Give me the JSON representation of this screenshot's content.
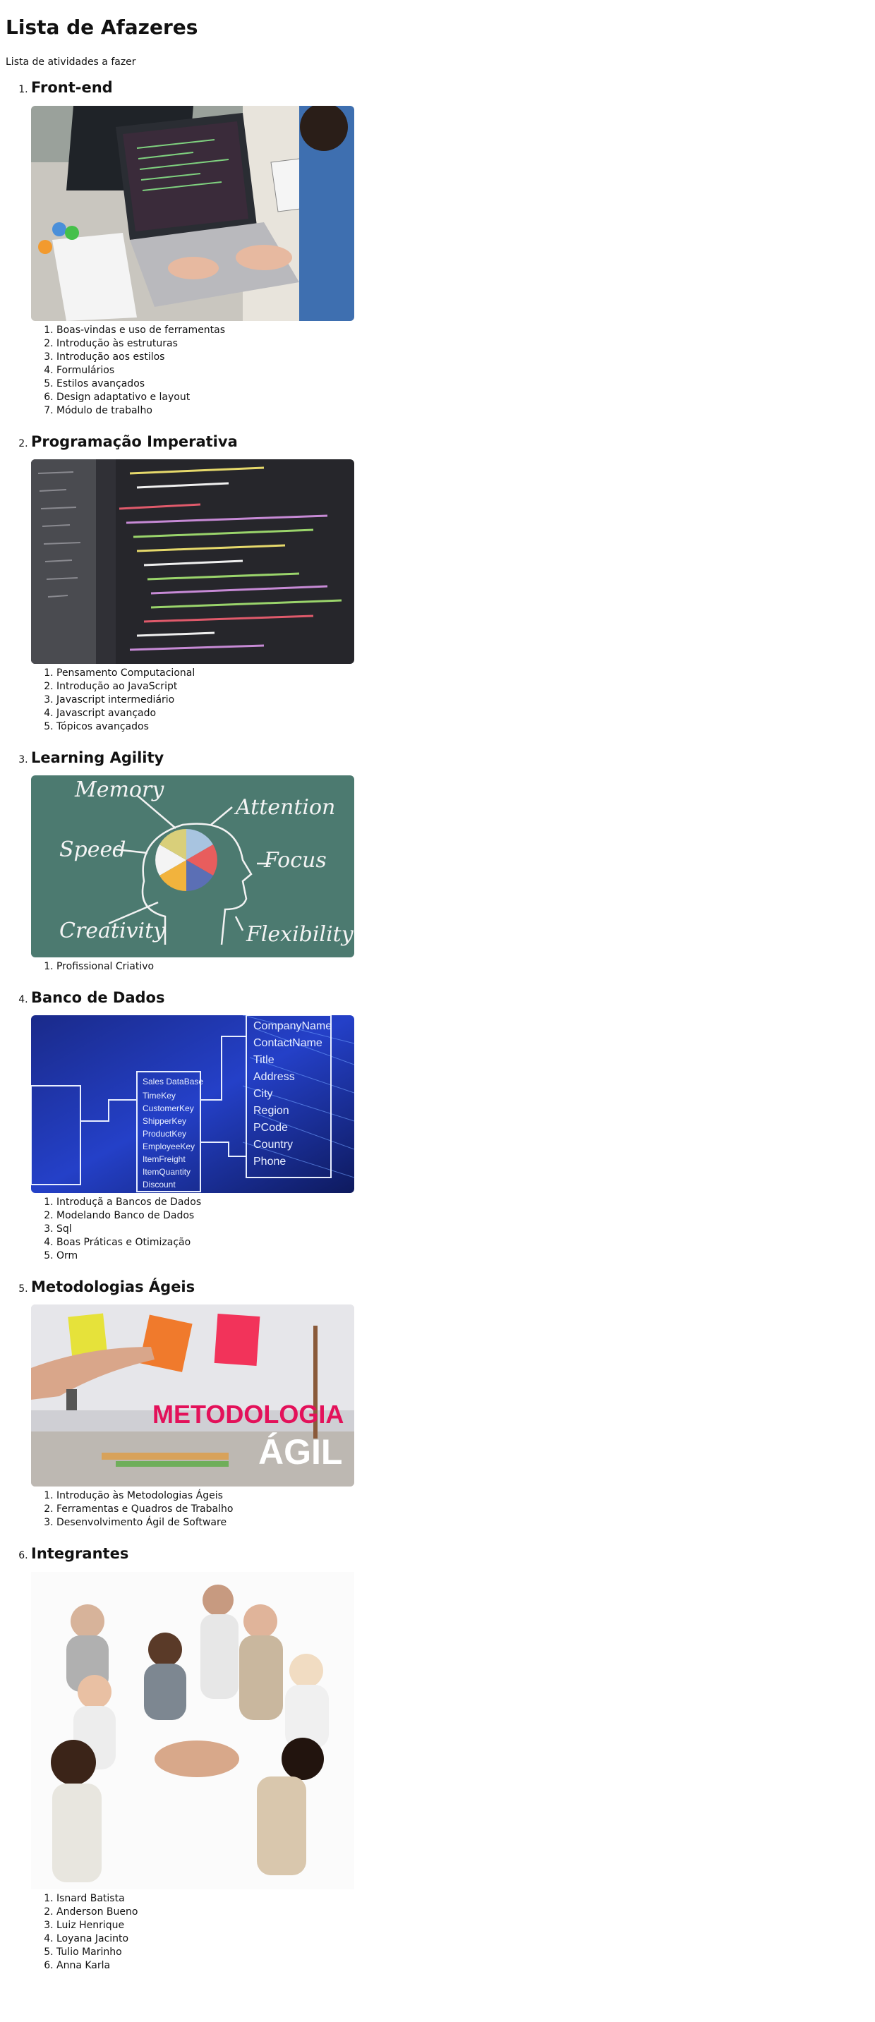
{
  "title": "Lista de Afazeres",
  "subtitle": "Lista de atividades a fazer",
  "sections": [
    {
      "title": "Front-end",
      "items": [
        "Boas-vindas e uso de ferramentas",
        "Introdução às estruturas",
        "Introdução aos estilos",
        "Formulários",
        "Estilos avançados",
        "Design adaptativo e layout",
        "Módulo de trabalho"
      ]
    },
    {
      "title": "Programação Imperativa",
      "items": [
        "Pensamento Computacional",
        "Introdução ao JavaScript",
        "Javascript intermediário",
        "Javascript avançado",
        "Tópicos avançados"
      ]
    },
    {
      "title": "Learning Agility",
      "image_text": {
        "w1": "Memory",
        "w2": "Attention",
        "w3": "Speed",
        "w4": "Focus",
        "w5": "Creativity",
        "w6": "Flexibility"
      },
      "items": [
        "Profissional Criativo"
      ]
    },
    {
      "title": "Banco de Dados",
      "items": [
        "Introduçã a Bancos de Dados",
        "Modelando Banco de Dados",
        "Sql",
        "Boas Práticas e Otimização",
        "Orm"
      ]
    },
    {
      "title": "Metodologias Ágeis",
      "image_text": {
        "line1": "METODOLOGIA",
        "line2": "ÁGIL"
      },
      "items": [
        "Introdução às Metodologias Ágeis",
        "Ferramentas e Quadros de Trabalho",
        "Desenvolvimento Ágil de Software"
      ]
    },
    {
      "title": "Integrantes",
      "items": [
        "Isnard Batista",
        "Anderson Bueno",
        "Luiz Henrique",
        "Loyana Jacinto",
        "Tulio Marinho",
        "Anna Karla"
      ]
    }
  ]
}
